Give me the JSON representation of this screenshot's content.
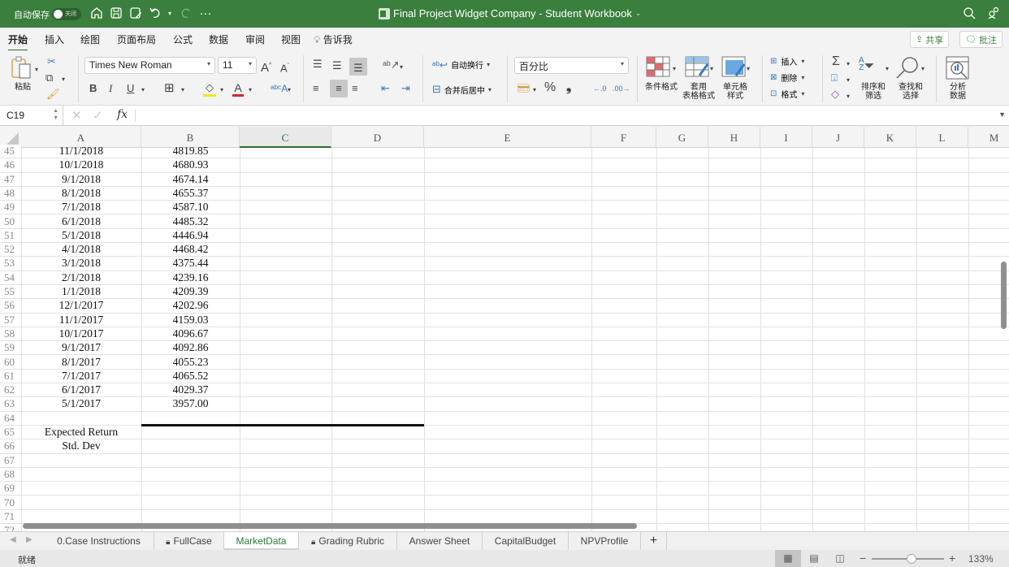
{
  "titlebar": {
    "autosave_label": "自动保存",
    "autosave_state": "关闭",
    "title": "Final Project Widget Company - Student Workbook",
    "icons": [
      "home-icon",
      "save-icon",
      "save-as-icon",
      "undo-icon",
      "redo-icon",
      "more-icon",
      "search-icon",
      "account-icon"
    ]
  },
  "ribbon_tabs": {
    "items": [
      "开始",
      "插入",
      "绘图",
      "页面布局",
      "公式",
      "数据",
      "审阅",
      "视图"
    ],
    "active": "开始",
    "tell_me": "告诉我",
    "share_label": "共享",
    "comment_label": "批注"
  },
  "ribbon": {
    "paste_label": "粘贴",
    "font_name": "Times New Roman",
    "font_size": "11",
    "wrap_text_label": "自动换行",
    "merge_center_label": "合并后居中",
    "number_format": "百分比",
    "conditional_format_label": "条件格式",
    "format_as_table_label_1": "套用",
    "format_as_table_label_2": "表格格式",
    "cell_styles_label_1": "单元格",
    "cell_styles_label_2": "样式",
    "insert_label": "插入",
    "delete_label": "删除",
    "format_label": "格式",
    "sort_filter_label_1": "排序和",
    "sort_filter_label_2": "筛选",
    "find_select_label_1": "查找和",
    "find_select_label_2": "选择",
    "analyze_label_1": "分析",
    "analyze_label_2": "数据",
    "bold": "B",
    "italic": "I",
    "underline": "U",
    "percent": "%",
    "comma": "❟"
  },
  "formula_bar": {
    "name_box": "C19",
    "fx": "fx",
    "formula": ""
  },
  "grid": {
    "columns": [
      "A",
      "B",
      "C",
      "D",
      "E",
      "F",
      "G",
      "H",
      "I",
      "J",
      "K",
      "L",
      "M"
    ],
    "selected_column": "C",
    "rows": [
      {
        "num": "45",
        "a": "11/1/2018",
        "b": "4819.85"
      },
      {
        "num": "46",
        "a": "10/1/2018",
        "b": "4680.93"
      },
      {
        "num": "47",
        "a": "9/1/2018",
        "b": "4674.14"
      },
      {
        "num": "48",
        "a": "8/1/2018",
        "b": "4655.37"
      },
      {
        "num": "49",
        "a": "7/1/2018",
        "b": "4587.10"
      },
      {
        "num": "50",
        "a": "6/1/2018",
        "b": "4485.32"
      },
      {
        "num": "51",
        "a": "5/1/2018",
        "b": "4446.94"
      },
      {
        "num": "52",
        "a": "4/1/2018",
        "b": "4468.42"
      },
      {
        "num": "53",
        "a": "3/1/2018",
        "b": "4375.44"
      },
      {
        "num": "54",
        "a": "2/1/2018",
        "b": "4239.16"
      },
      {
        "num": "55",
        "a": "1/1/2018",
        "b": "4209.39"
      },
      {
        "num": "56",
        "a": "12/1/2017",
        "b": "4202.96"
      },
      {
        "num": "57",
        "a": "11/1/2017",
        "b": "4159.03"
      },
      {
        "num": "58",
        "a": "10/1/2017",
        "b": "4096.67"
      },
      {
        "num": "59",
        "a": "9/1/2017",
        "b": "4092.86"
      },
      {
        "num": "60",
        "a": "8/1/2017",
        "b": "4055.23"
      },
      {
        "num": "61",
        "a": "7/1/2017",
        "b": "4065.52"
      },
      {
        "num": "62",
        "a": "6/1/2017",
        "b": "4029.37"
      },
      {
        "num": "63",
        "a": "5/1/2017",
        "b": "3957.00"
      },
      {
        "num": "64",
        "a": "",
        "b": ""
      },
      {
        "num": "65",
        "a": "Expected Return",
        "b": ""
      },
      {
        "num": "66",
        "a": "Std. Dev",
        "b": ""
      },
      {
        "num": "67",
        "a": "",
        "b": ""
      },
      {
        "num": "68",
        "a": "",
        "b": ""
      },
      {
        "num": "69",
        "a": "",
        "b": ""
      },
      {
        "num": "70",
        "a": "",
        "b": ""
      },
      {
        "num": "71",
        "a": "",
        "b": ""
      },
      {
        "num": "72",
        "a": "",
        "b": ""
      }
    ]
  },
  "sheet_tabs": {
    "items": [
      {
        "label": "0.Case Instructions",
        "locked": false
      },
      {
        "label": "FullCase",
        "locked": true
      },
      {
        "label": "MarketData",
        "locked": false
      },
      {
        "label": "Grading Rubric",
        "locked": true
      },
      {
        "label": "Answer Sheet",
        "locked": false
      },
      {
        "label": "CapitalBudget",
        "locked": false
      },
      {
        "label": "NPVProfile",
        "locked": false
      }
    ],
    "active": "MarketData",
    "add_label": "+"
  },
  "statusbar": {
    "status": "就绪",
    "zoom": "133%",
    "zoom_value": 133
  }
}
